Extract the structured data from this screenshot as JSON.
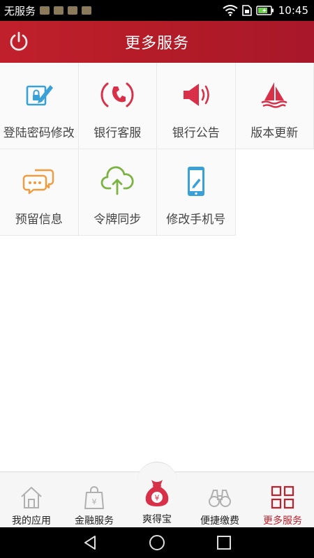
{
  "status_bar": {
    "carrier": "无服务",
    "time": "10:45"
  },
  "header": {
    "title": "更多服务",
    "power_icon": "power-icon"
  },
  "services": [
    {
      "label": "登陆密码修改",
      "icon": "lock-edit-icon",
      "color": "#3aa0d8"
    },
    {
      "label": "银行客服",
      "icon": "phone-icon",
      "color": "#d9304a"
    },
    {
      "label": "银行公告",
      "icon": "megaphone-icon",
      "color": "#d9304a"
    },
    {
      "label": "版本更新",
      "icon": "sailboat-icon",
      "color": "#d9304a"
    },
    {
      "label": "预留信息",
      "icon": "chat-bubbles-icon",
      "color": "#f39a3c"
    },
    {
      "label": "令牌同步",
      "icon": "cloud-sync-icon",
      "color": "#7cb342"
    },
    {
      "label": "修改手机号",
      "icon": "mobile-edit-icon",
      "color": "#3aa0d8"
    }
  ],
  "bottom_nav": [
    {
      "label": "我的应用",
      "icon": "home-icon",
      "active": false
    },
    {
      "label": "金融服务",
      "icon": "shopping-bag-yen-icon",
      "active": false
    },
    {
      "label": "爽得宝",
      "icon": "money-bag-yen-icon",
      "active": false
    },
    {
      "label": "便捷缴费",
      "icon": "binoculars-icon",
      "active": false
    },
    {
      "label": "更多服务",
      "icon": "grid-icon",
      "active": true
    }
  ],
  "colors": {
    "header": "#b51c27",
    "accent": "#c0202c",
    "text": "#444444"
  }
}
